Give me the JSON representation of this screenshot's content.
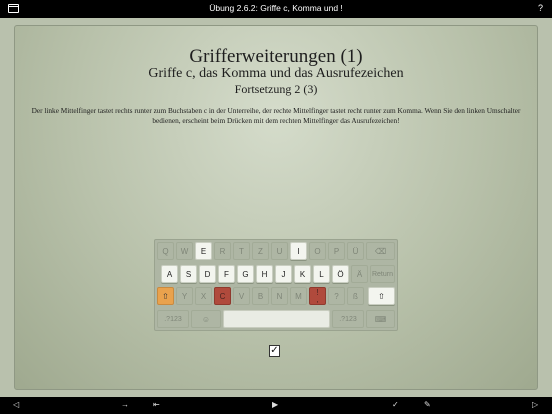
{
  "topbar": {
    "title": "Übung 2.6.2: Griffe c, Komma und !",
    "help": "?"
  },
  "lesson": {
    "title": "Grifferweiterungen (1)",
    "subtitle": "Griffe c, das Komma und das Ausrufezeichen",
    "section": "Fortsetzung 2 (3)",
    "description": "Der linke Mittelfinger tastet rechts runter zum Buchstaben c in der Unterreihe, der rechte Mittelfinger tastet recht runter zum Komma. Wenn Sie den linken Umschalter bedienen, erscheint beim Drücken mit dem rechten Mittelfinger das Ausrufezeichen!"
  },
  "keyboard": {
    "row1": [
      "Q",
      "W",
      "E",
      "R",
      "T",
      "Z",
      "U",
      "I",
      "O",
      "P",
      "Ü",
      "⌫"
    ],
    "row2": [
      "A",
      "S",
      "D",
      "F",
      "G",
      "H",
      "J",
      "K",
      "L",
      "Ö",
      "Ä",
      "Return"
    ],
    "row3": [
      "⇧",
      "Y",
      "X",
      "C",
      "V",
      "B",
      "N",
      "M",
      ",",
      "?",
      "ß",
      "⇧"
    ],
    "row3_comma_alt": "!",
    "row4": [
      ".?123",
      "☺",
      "",
      ".?123",
      "⌨"
    ]
  },
  "checkbox": {
    "mark": "✓"
  },
  "bottombar": {
    "back": "◁",
    "arrow": "→",
    "stepback": "⇤",
    "play": "▶",
    "check": "✓",
    "pencil": "✎",
    "forward": "▷"
  }
}
